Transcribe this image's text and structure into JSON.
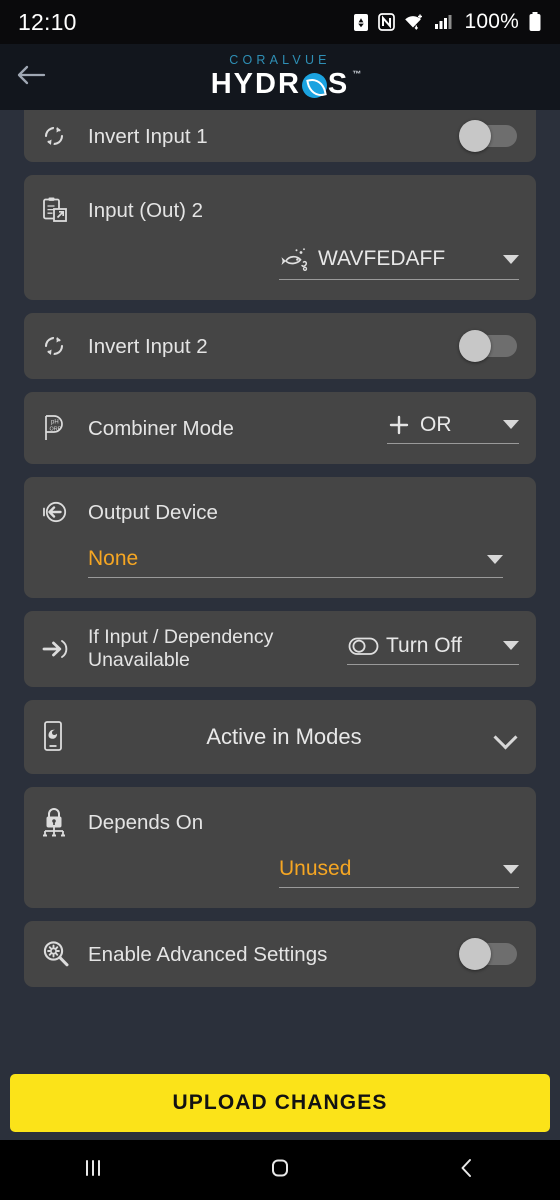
{
  "status_bar": {
    "time": "12:10",
    "battery_percent": "100%",
    "icons": [
      "data-saver-icon",
      "nfc-icon",
      "wifi-icon",
      "cellular-signal-icon",
      "battery-icon"
    ]
  },
  "app_bar": {
    "back_icon": "back-arrow-icon",
    "brand_top": "CORALVUE",
    "brand_main_left": "HYDR",
    "brand_main_right": "S",
    "brand_badge": "leaf-badge-icon",
    "trademark": "™",
    "brand_top_color": "#2e8fb5",
    "badge_color": "#1ba3e0"
  },
  "theme": {
    "page_background": "#2b303b",
    "card_background": "#454545",
    "accent_orange": "#f5a623",
    "upload_yellow": "#fbe319",
    "text_primary": "#e4e4e4"
  },
  "settings": [
    {
      "id": "invert-input-1",
      "icon": "refresh-invert-icon",
      "label": "Invert Input 1",
      "control": "toggle",
      "value": "off",
      "partial": true
    },
    {
      "id": "input-out-2",
      "icon": "clipboard-output-icon",
      "label": "Input (Out) 2",
      "control": "dropdown-below-right",
      "value": "WAVFEDAFF",
      "value_icon": "fish-icon",
      "accent": false
    },
    {
      "id": "invert-input-2",
      "icon": "refresh-invert-icon",
      "label": "Invert Input 2",
      "control": "toggle",
      "value": "off"
    },
    {
      "id": "combiner-mode",
      "icon": "ph-orp-probe-icon",
      "label": "Combiner Mode",
      "control": "dropdown-inline",
      "value": "OR",
      "value_icon": "plus-icon",
      "accent": false
    },
    {
      "id": "output-device",
      "icon": "output-arrow-icon",
      "label": "Output Device",
      "control": "dropdown-below-left",
      "value": "None",
      "accent": true
    },
    {
      "id": "input-dependency-unavailable",
      "icon": "input-arrow-icon",
      "label": "If Input / Dependency Unavailable",
      "control": "dropdown-inline",
      "value": "Turn Off",
      "value_icon": "toggle-outline-icon",
      "accent": false
    },
    {
      "id": "active-in-modes",
      "icon": "device-wave-icon",
      "label": "Active in Modes",
      "control": "expander",
      "expand_icon": "chevron-down-icon"
    },
    {
      "id": "depends-on",
      "icon": "lock-dependency-icon",
      "label": "Depends On",
      "control": "dropdown-below-right",
      "value": "Unused",
      "accent": true
    },
    {
      "id": "enable-advanced-settings",
      "icon": "magnifier-gear-icon",
      "label": "Enable Advanced Settings",
      "control": "toggle",
      "value": "off"
    }
  ],
  "upload_button": {
    "label": "UPLOAD CHANGES"
  },
  "nav_bar": {
    "recents_icon": "recents-icon",
    "home_icon": "home-icon",
    "back_icon": "nav-back-icon"
  }
}
